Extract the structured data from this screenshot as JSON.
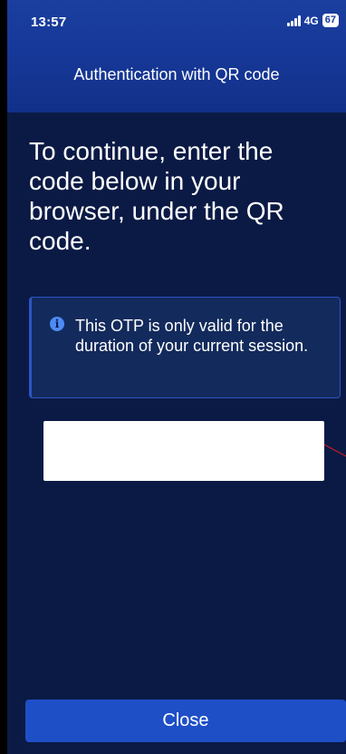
{
  "status_bar": {
    "time": "13:57",
    "network": "4G",
    "battery": "67"
  },
  "header": {
    "title": "Authentication with QR code"
  },
  "main": {
    "instructions": "To continue, enter the code below in your browser, under the QR code.",
    "info": {
      "icon": "info-icon",
      "text": "This OTP is only valid for the duration of your current session."
    },
    "otp_value": ""
  },
  "footer": {
    "close_label": "Close"
  },
  "colors": {
    "background": "#0b1a45",
    "header": "#17399a",
    "accent": "#1e4fc7",
    "info_border": "#2c56c4"
  }
}
